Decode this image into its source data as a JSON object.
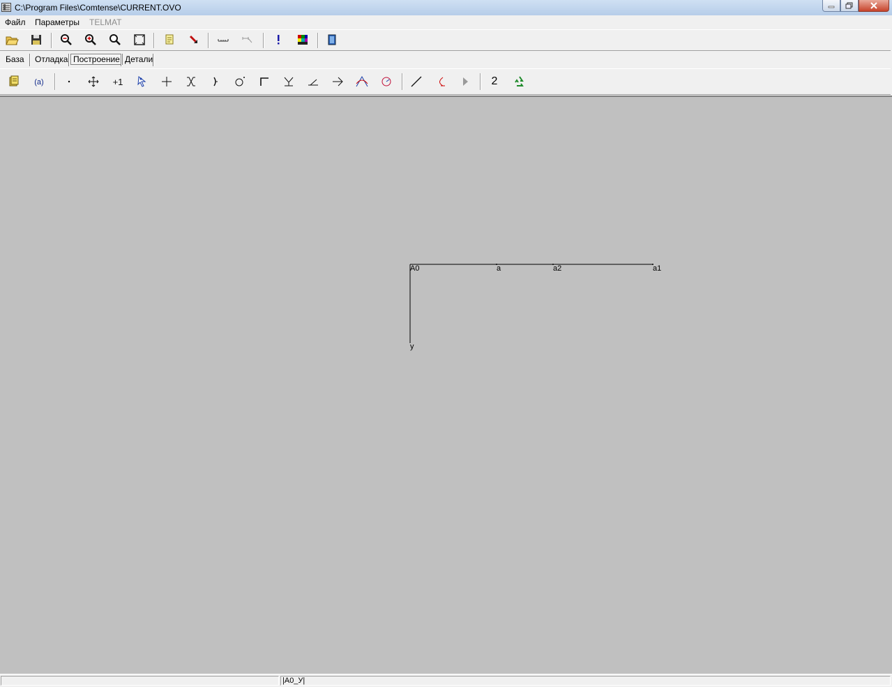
{
  "window": {
    "title": "C:\\Program Files\\Comtense\\CURRENT.OVO",
    "app_icon": "app-icon",
    "buttons": [
      "minimize-icon",
      "restore-icon",
      "close-icon"
    ]
  },
  "menu": {
    "items": [
      {
        "label": "Файл",
        "enabled": true
      },
      {
        "label": "Параметры",
        "enabled": true
      },
      {
        "label": "TELMAT",
        "enabled": false
      }
    ]
  },
  "toolbar_main": {
    "buttons": [
      "open-folder-icon",
      "save-disk-icon",
      "zoom-out-icon",
      "zoom-in-icon",
      "zoom-icon",
      "fit-window-icon",
      "document-icon",
      "delete-arrow-icon",
      "measure-icon",
      "measure-angle-icon",
      "exclamation-icon",
      "palette-icon",
      "book-exit-icon"
    ]
  },
  "tabs": {
    "items": [
      "База",
      "Отладка",
      "Построение",
      "Детали"
    ],
    "active": "Построение"
  },
  "toolbar_build": {
    "buttons": [
      "notes-icon",
      "variable-icon",
      "point-icon",
      "move-point-icon",
      "plus-one-icon",
      "select-icon",
      "cross-icon",
      "intersection-icon",
      "bracket-icon",
      "circle-point-icon",
      "corner-icon",
      "perpendicular-icon",
      "angle-icon",
      "arrow-right-icon",
      "curve-icon",
      "arc-point-icon",
      "line-icon",
      "curve-left-icon",
      "play-icon",
      "number-icon",
      "recycle-icon"
    ],
    "number_label": "2"
  },
  "drawing": {
    "points": [
      "A0",
      "a",
      "a2",
      "a1",
      "у"
    ]
  },
  "status": {
    "panel1": "",
    "panel2": "|A0_У|"
  }
}
